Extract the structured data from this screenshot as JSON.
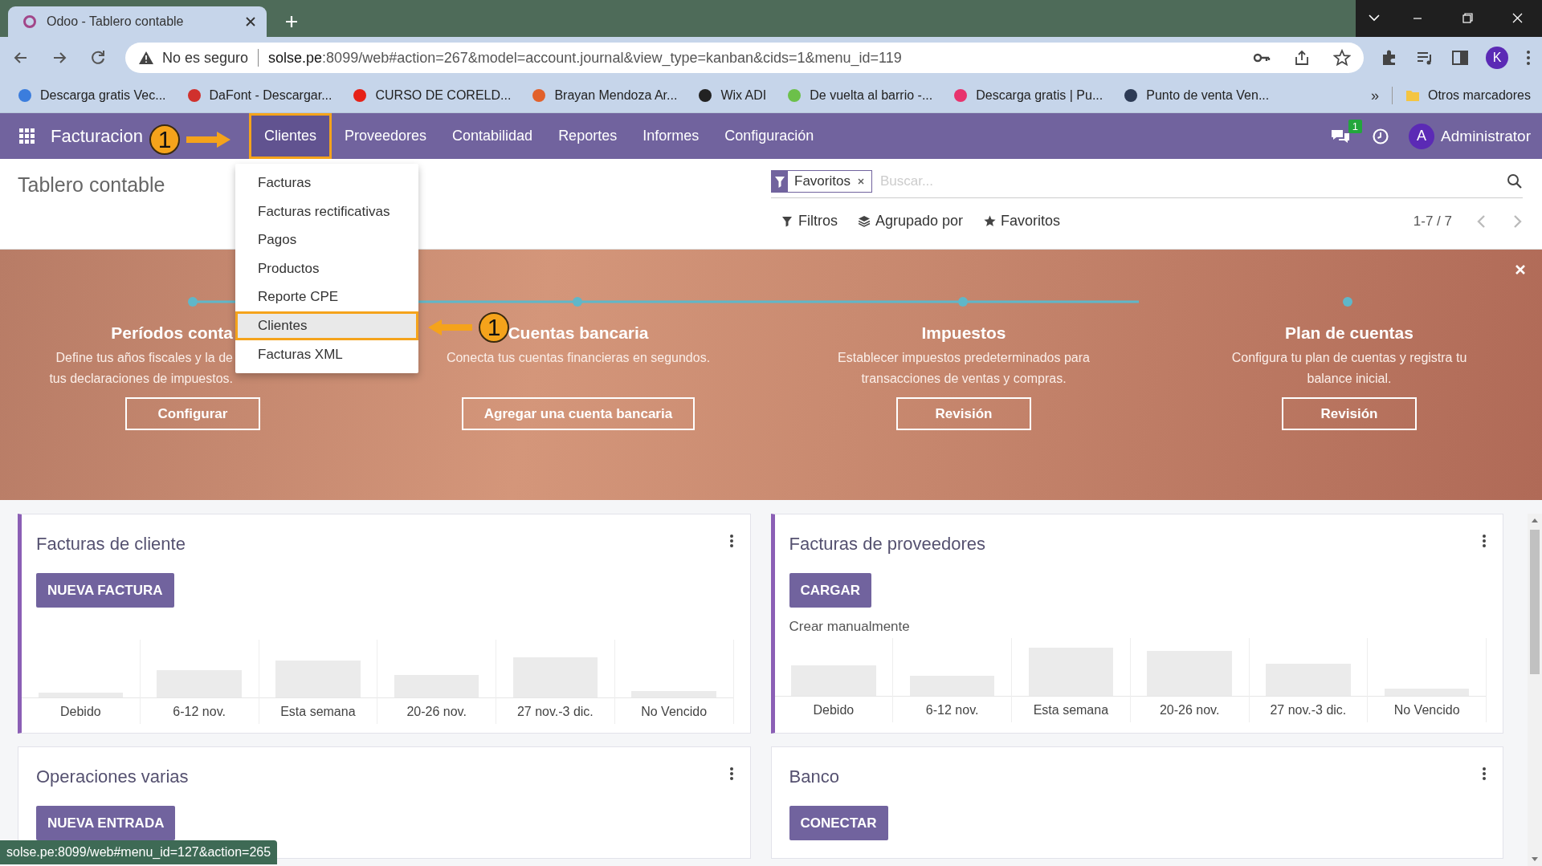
{
  "browser": {
    "tab": {
      "title": "Odoo - Tablero contable",
      "selected": true
    },
    "address": {
      "security": "No es seguro",
      "host": "solse.pe",
      "path": ":8099/web#action=267&model=account.journal&view_type=kanban&cids=1&menu_id=119"
    },
    "profile_initial": "K",
    "bookmarks": [
      {
        "label": "Descarga gratis Vec...",
        "color": "#3b7ddd"
      },
      {
        "label": "DaFont - Descargar...",
        "color": "#d0312d"
      },
      {
        "label": "CURSO DE CORELD...",
        "color": "#e62117"
      },
      {
        "label": "Brayan Mendoza Ar...",
        "color": "#e2612b"
      },
      {
        "label": "Wix ADI",
        "color": "#222222"
      },
      {
        "label": "De vuelta al barrio -...",
        "color": "#6cc04a"
      },
      {
        "label": "Descarga gratis | Pu...",
        "color": "#e8336d"
      },
      {
        "label": "Punto de venta Ven...",
        "color": "#2d3b55"
      }
    ],
    "bookmarks_more": "»",
    "other_bookmarks": "Otros marcadores"
  },
  "navbar": {
    "app_title": "Facturacion",
    "menus": [
      {
        "label": "Clientes",
        "selected": true
      },
      {
        "label": "Proveedores",
        "selected": false
      },
      {
        "label": "Contabilidad",
        "selected": false
      },
      {
        "label": "Reportes",
        "selected": false
      },
      {
        "label": "Informes",
        "selected": false
      },
      {
        "label": "Configuración",
        "selected": false
      }
    ],
    "messages_count": "1",
    "user": {
      "initial": "A",
      "name": "Administrator"
    }
  },
  "dropdown": {
    "items": [
      {
        "label": "Facturas",
        "selected": false
      },
      {
        "label": "Facturas rectificativas",
        "selected": false
      },
      {
        "label": "Pagos",
        "selected": false
      },
      {
        "label": "Productos",
        "selected": false
      },
      {
        "label": "Reporte CPE",
        "selected": false
      },
      {
        "label": "Clientes",
        "selected": true
      },
      {
        "label": "Facturas XML",
        "selected": false
      }
    ]
  },
  "control_panel": {
    "breadcrumb": "Tablero contable",
    "facet": "Favoritos",
    "search": {
      "placeholder": "Buscar..."
    },
    "filters": [
      {
        "label": "Filtros",
        "kind": "filter"
      },
      {
        "label": "Agrupado por",
        "kind": "group"
      },
      {
        "label": "Favoritos",
        "kind": "star"
      }
    ],
    "pager": "1-7 / 7"
  },
  "banner": {
    "steps": [
      {
        "title": "Períodos conta",
        "description": "Define tus años fiscales y la de tus declaraciones de impuestos.",
        "button": "Configurar"
      },
      {
        "title": "Cuentas bancaria",
        "description": "Conecta tus cuentas financieras en segundos.",
        "button": "Agregar una cuenta bancaria"
      },
      {
        "title": "Impuestos",
        "description": "Establecer impuestos predeterminados para transacciones de ventas y compras.",
        "button": "Revisión"
      },
      {
        "title": "Plan de cuentas",
        "description": "Configura tu plan de cuentas y registra tu balance inicial.",
        "button": "Revisión"
      }
    ]
  },
  "cards": [
    {
      "title": "Facturas de cliente",
      "accent_bar": true,
      "button": "NUEVA FACTURA",
      "chart_labels": [
        "Debido",
        "6-12 nov.",
        "Esta semana",
        "20-26 nov.",
        "27 nov.-3 dic.",
        "No Vencido"
      ]
    },
    {
      "title": "Facturas de proveedores",
      "accent_bar": true,
      "button": "CARGAR",
      "link": "Crear manualmente",
      "chart_labels": [
        "Debido",
        "6-12 nov.",
        "Esta semana",
        "20-26 nov.",
        "27 nov.-3 dic.",
        "No Vencido"
      ]
    },
    {
      "title": "Operaciones varias",
      "accent_bar": false,
      "button": "NUEVA ENTRADA"
    },
    {
      "title": "Banco",
      "accent_bar": false,
      "button": "CONECTAR"
    }
  ],
  "annotations": [
    {
      "label": "1"
    },
    {
      "label": "1"
    }
  ],
  "status_bar": {
    "url": "solse.pe:8099/web#menu_id=127&action=265"
  }
}
